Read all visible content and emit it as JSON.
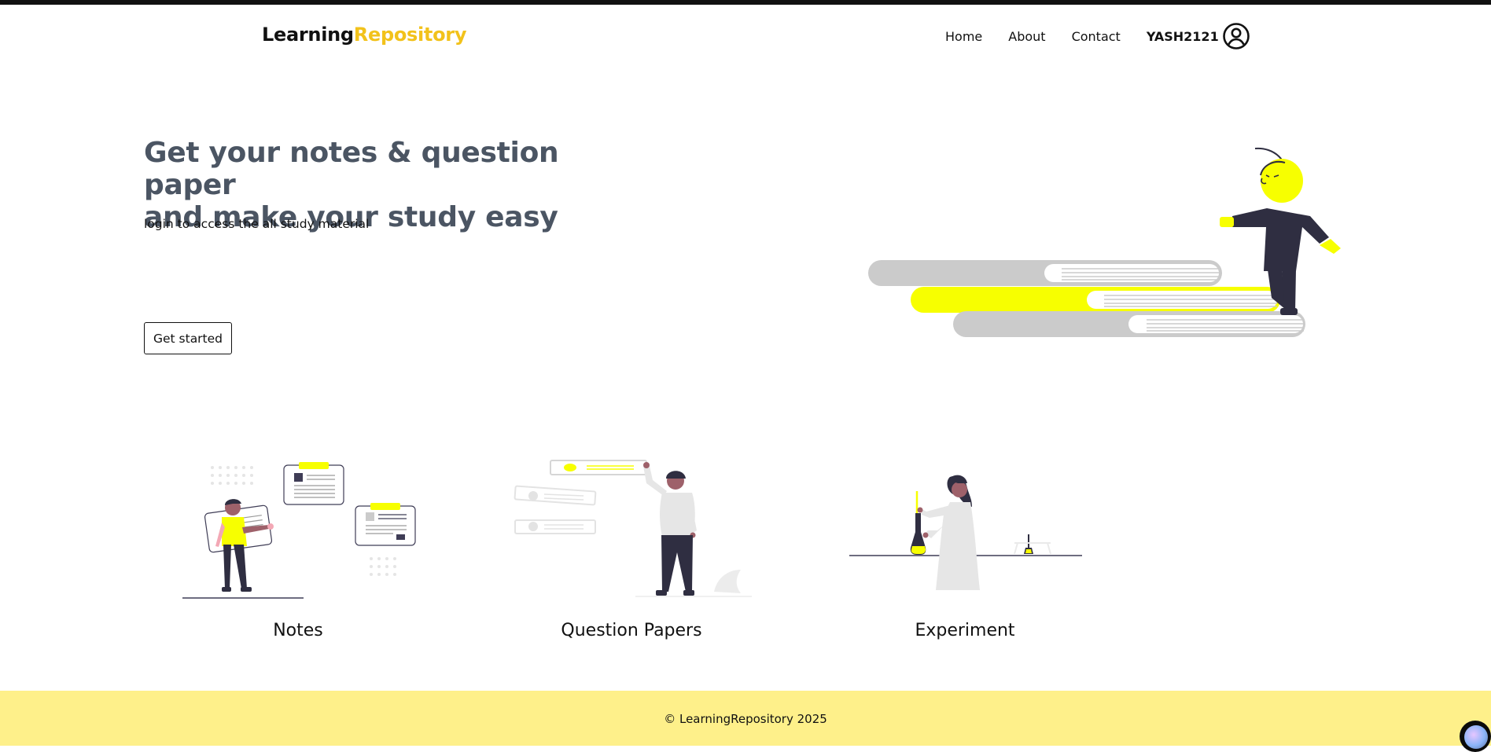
{
  "brand": {
    "part1": "Learning",
    "part2": "Repository"
  },
  "nav": {
    "links": [
      "Home",
      "About",
      "Contact"
    ],
    "username": "YASH2121",
    "avatar_icon": "user-circle-icon"
  },
  "hero": {
    "title_line1": "Get your notes & question paper",
    "title_line2": "and make your study easy",
    "subtitle": "login to access the all study material",
    "cta": "Get started"
  },
  "cards": [
    {
      "label": "Notes",
      "icon": "notes-illustration"
    },
    {
      "label": "Question Papers",
      "icon": "question-papers-illustration"
    },
    {
      "label": "Experiment",
      "icon": "experiment-illustration"
    }
  ],
  "footer": {
    "text": "© LearningRepository 2025"
  },
  "colors": {
    "accent": "#f2c21b",
    "highlight": "#f7ff00",
    "footer_bg": "#fef08a",
    "heading": "#4b5563",
    "dark_figure": "#2f2e41"
  }
}
